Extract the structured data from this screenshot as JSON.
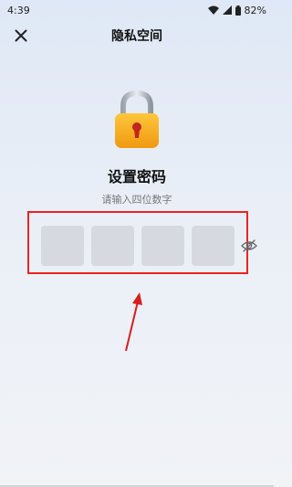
{
  "status_bar": {
    "time": "4:39",
    "battery": "82%"
  },
  "header": {
    "title": "隐私空间"
  },
  "page": {
    "heading": "设置密码",
    "hint": "请输入四位数字"
  },
  "pin": {
    "digits": 4,
    "values": [
      "",
      "",
      "",
      ""
    ]
  },
  "colors": {
    "highlight": "#e22222",
    "lock_body": "#f2a81d",
    "box_fill": "#d6d9e0"
  },
  "icons": [
    "close-icon",
    "lock-icon",
    "eye-off-icon",
    "wifi-icon",
    "signal-icon",
    "battery-icon"
  ]
}
